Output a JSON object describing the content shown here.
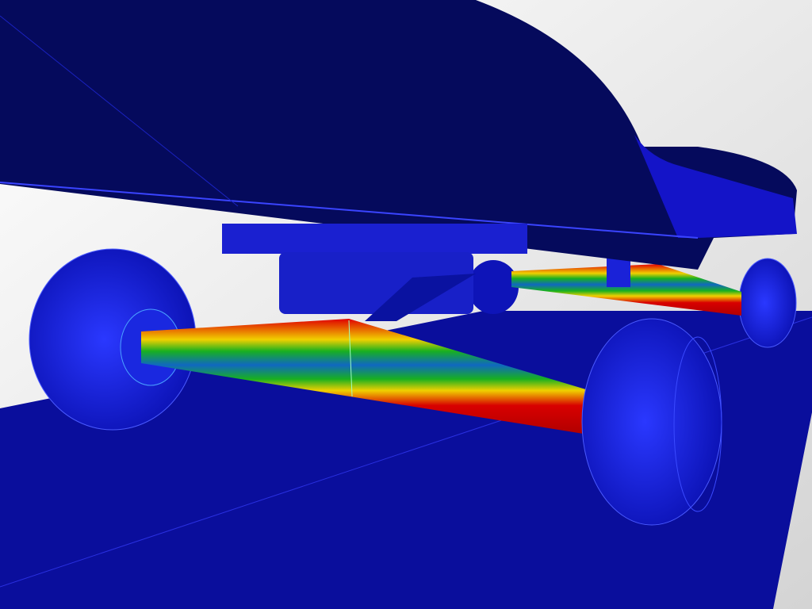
{
  "scene": {
    "subject": "skateboard-truck-stress-render",
    "colors": {
      "background_light": "#f4f4f4",
      "background_gray": "#d8d8d8",
      "ground": "#0a0e9c",
      "deck_top": "#050a5c",
      "deck_edge": "#1414c8",
      "part_blue": "#1620d0",
      "stress_high": "#cc0000",
      "stress_mid_high": "#e8d000",
      "stress_mid": "#10b020",
      "stress_low": "#1070c0"
    }
  }
}
